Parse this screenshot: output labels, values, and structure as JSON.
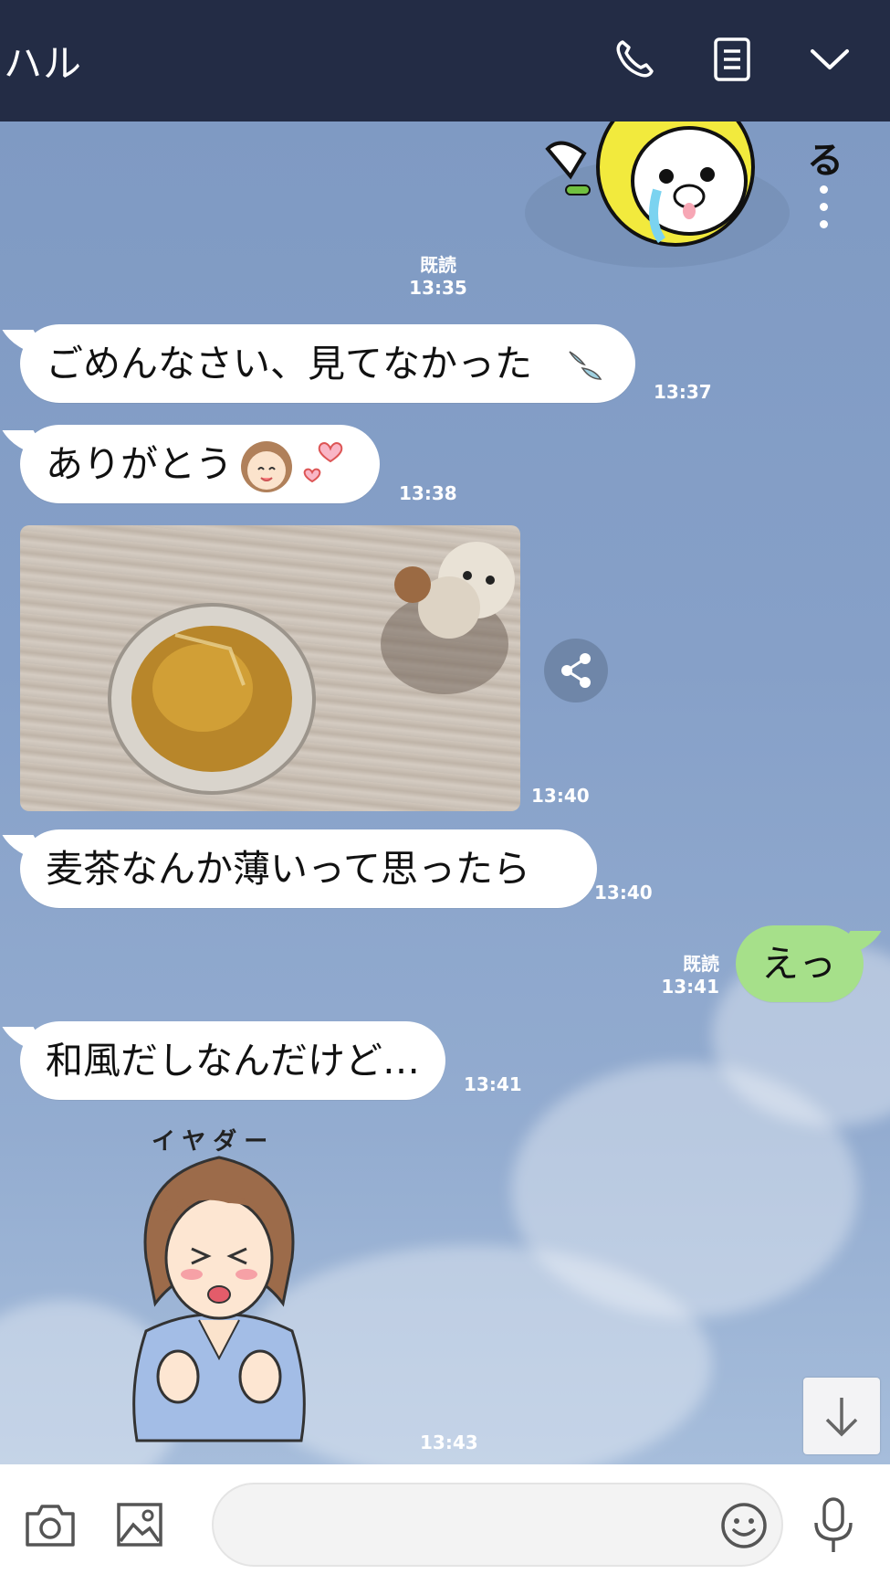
{
  "header": {
    "title": "ハル",
    "icons": [
      "phone-icon",
      "notes-icon",
      "chevron-down-icon"
    ]
  },
  "messages": [
    {
      "side": "right",
      "kind": "sticker",
      "read": "既読",
      "time": "13:35"
    },
    {
      "side": "left",
      "text": "ごめんなさい、見てなかった",
      "time": "13:37"
    },
    {
      "side": "left",
      "text": "ありがとう",
      "time": "13:38"
    },
    {
      "side": "left",
      "kind": "photo",
      "time": "13:40"
    },
    {
      "side": "left",
      "text": "麦茶なんか薄いって思ったら",
      "time": "13:40"
    },
    {
      "side": "right",
      "text": "えっ",
      "read": "既読",
      "time": "13:41"
    },
    {
      "side": "left",
      "text": "和風だしなんだけど…",
      "time": "13:41"
    },
    {
      "side": "left",
      "kind": "sticker",
      "sticker_text": "イヤダー",
      "time": "13:43"
    }
  ],
  "colors": {
    "header": "#232c45",
    "chat_bg": "#8aa3c7",
    "sent_bubble": "#a6e08a",
    "received_bubble": "#ffffff"
  },
  "footer": {
    "icons": [
      "camera-icon",
      "image-icon",
      "emoji-icon",
      "mic-icon"
    ]
  }
}
